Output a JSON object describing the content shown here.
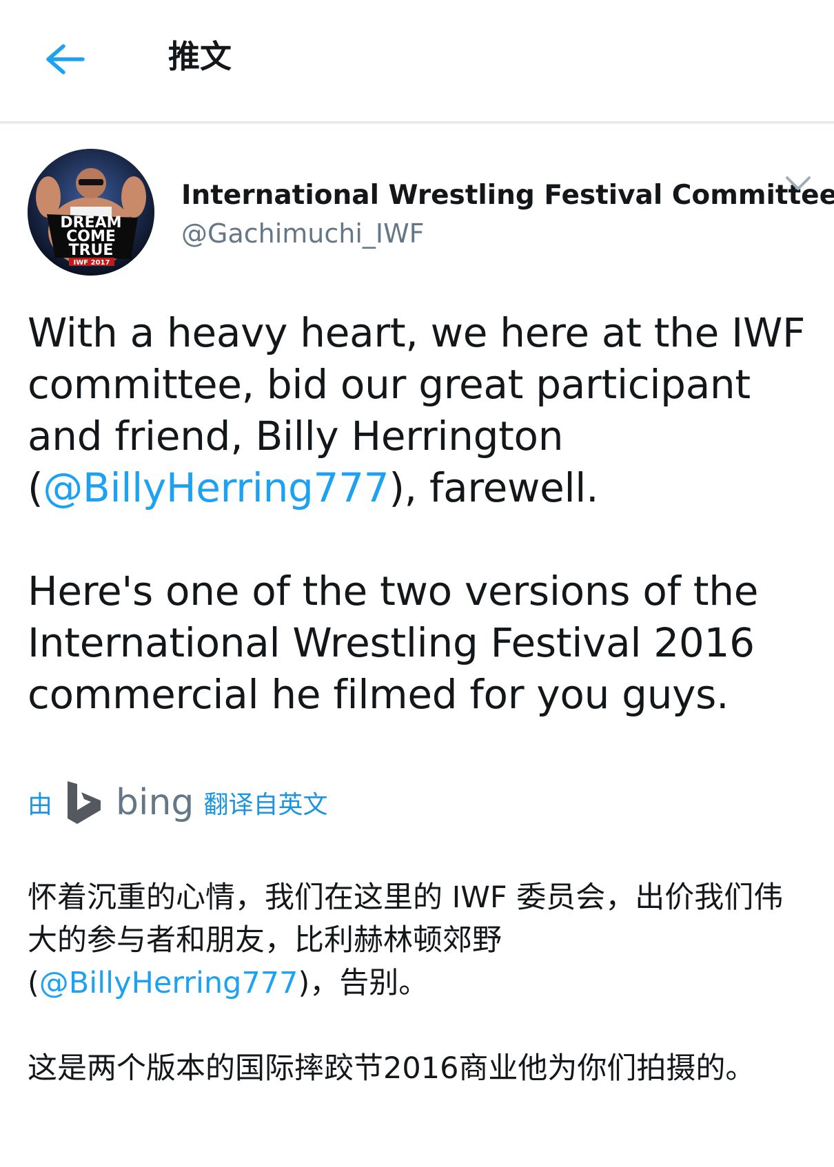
{
  "header": {
    "title": "推文"
  },
  "tweet": {
    "author_name": "International Wrestling Festival Committee",
    "author_handle": "@Gachimuchi_IWF",
    "avatar_text": [
      "DREAM",
      "COME",
      "TRUE",
      "IWF 2017"
    ],
    "text_para1_part1": "With a heavy heart, we here at the IWF committee, bid our great participant and friend, Billy Herrington (",
    "text_para1_mention": "@BillyHerring777",
    "text_para1_part2": "), farewell.",
    "text_para2": "Here's one of the two versions of the International Wrestling Festival 2016 commercial he filmed for you guys."
  },
  "translation_bar": {
    "prefix": "由",
    "provider": "bing",
    "suffix": "翻译自英文"
  },
  "translation": {
    "para1_part1": "怀着沉重的心情，我们在这里的 IWF 委员会，出价我们伟大的参与者和朋友，比利赫林顿郊野 (",
    "para1_mention": "@BillyHerring777",
    "para1_part2": ")，告别。",
    "para2": "这是两个版本的国际摔跤节2016商业他为你们拍摄的。"
  },
  "colors": {
    "accent": "#1da1f2",
    "text": "#14171a",
    "secondary": "#657786"
  }
}
